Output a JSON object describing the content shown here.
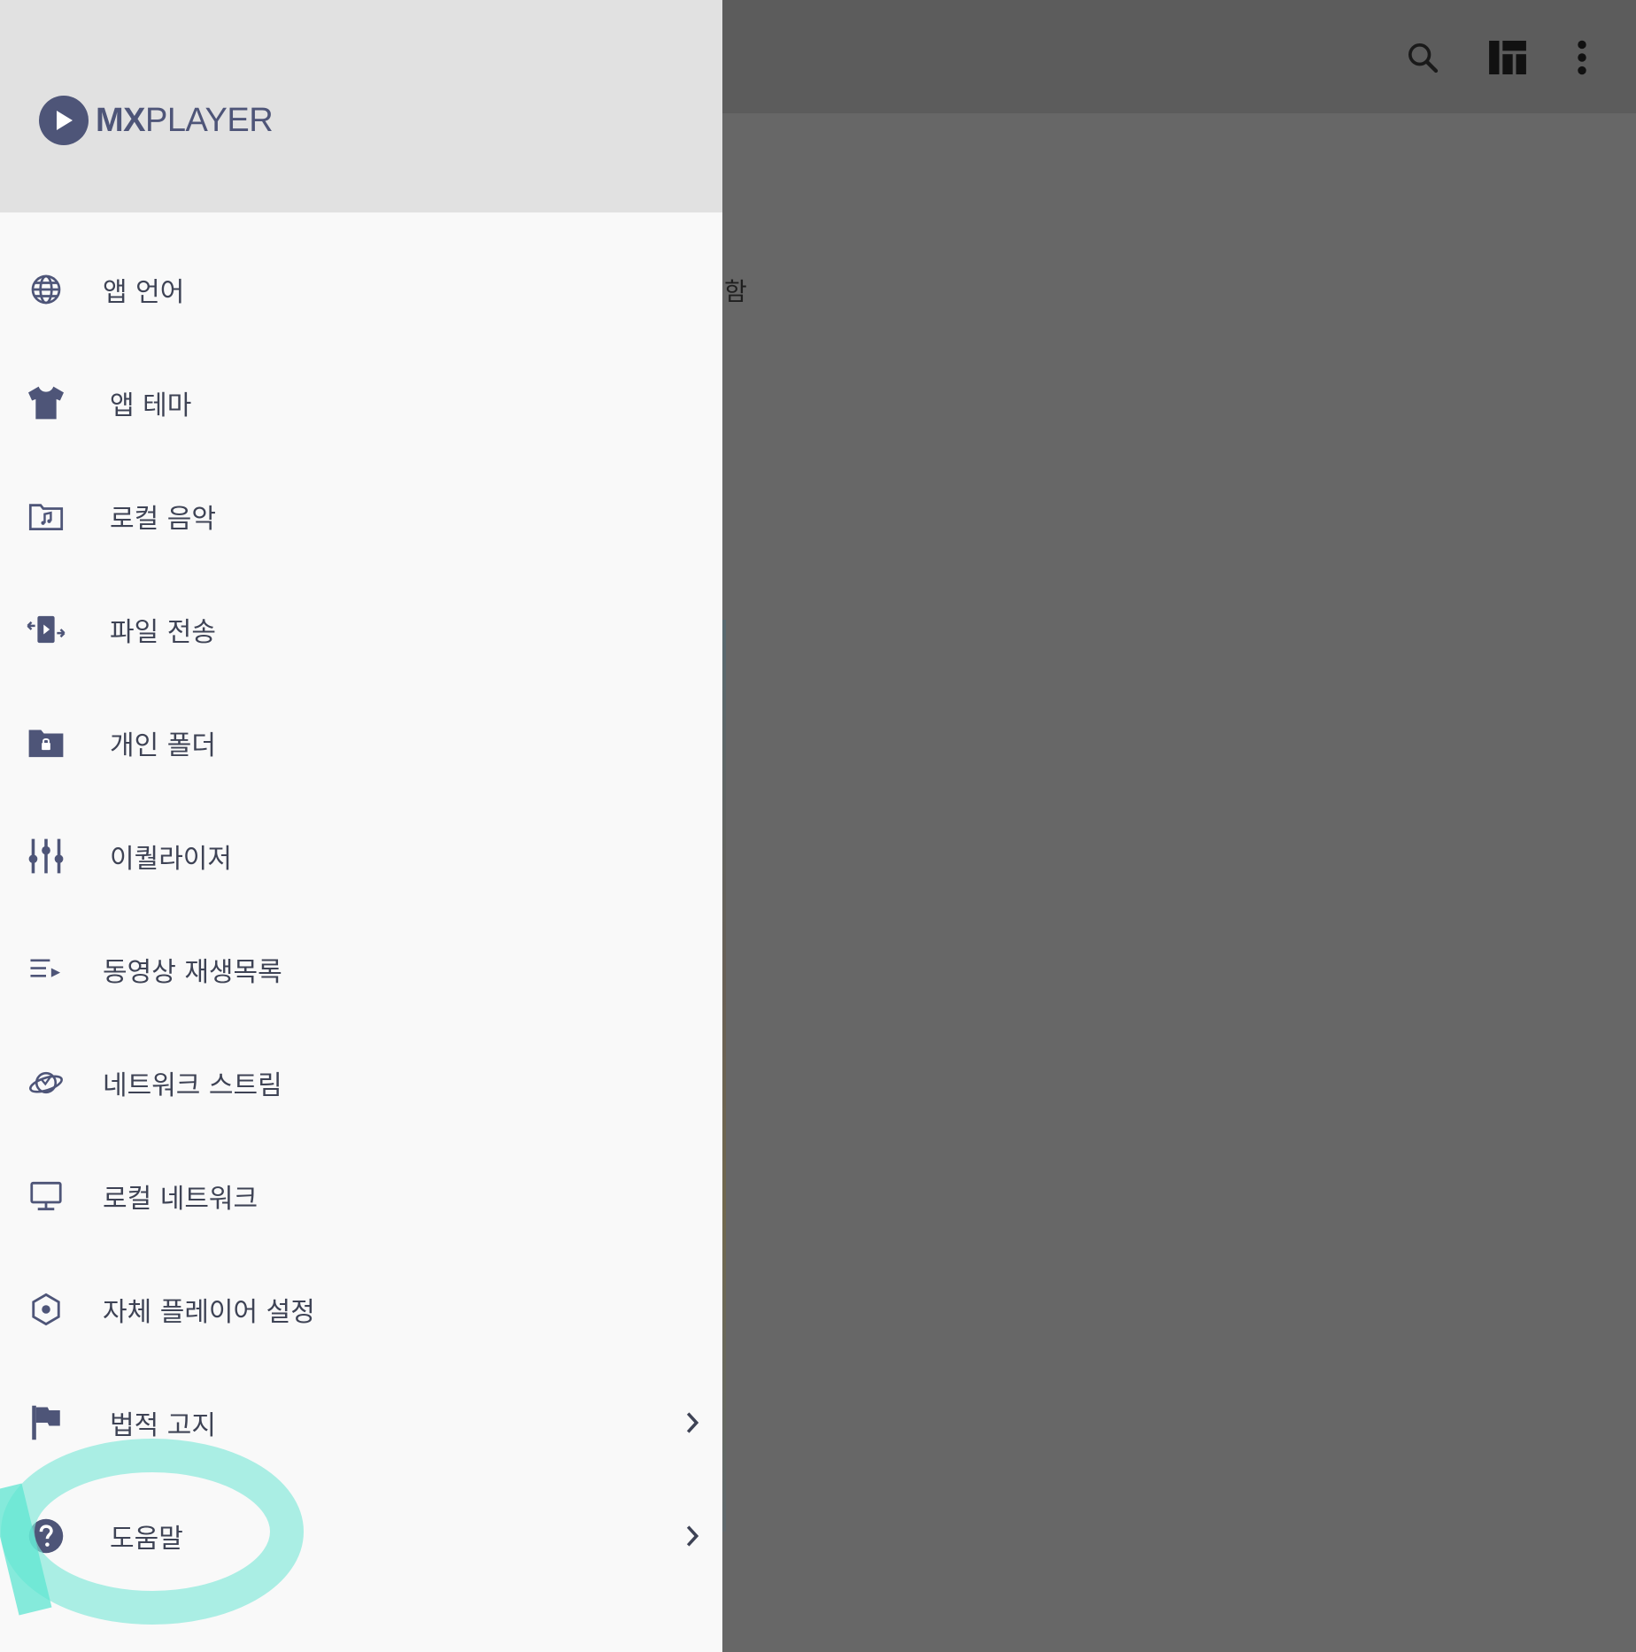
{
  "background": {
    "partial_text": "함",
    "toolbar": {
      "search_icon": "search-icon",
      "layout_icon": "grid-layout-icon",
      "more_icon": "more-vertical-icon"
    }
  },
  "drawer": {
    "logo": {
      "mx": "MX",
      "player": "PLAYER"
    },
    "items": [
      {
        "label": "앱 언어",
        "icon": "globe-icon"
      },
      {
        "label": "앱 테마",
        "icon": "tshirt-icon"
      },
      {
        "label": "로컬 음악",
        "icon": "music-folder-icon"
      },
      {
        "label": "파일 전송",
        "icon": "file-transfer-icon"
      },
      {
        "label": "개인 폴더",
        "icon": "lock-folder-icon"
      },
      {
        "label": "이퀄라이저",
        "icon": "equalizer-icon"
      },
      {
        "label": "동영상 재생목록",
        "icon": "playlist-icon"
      },
      {
        "label": "네트워크 스트림",
        "icon": "planet-icon"
      },
      {
        "label": "로컬 네트워크",
        "icon": "monitor-icon"
      },
      {
        "label": "자체 플레이어 설정",
        "icon": "hexagon-settings-icon"
      },
      {
        "label": "법적 고지",
        "icon": "flag-icon",
        "has_chevron": true
      },
      {
        "label": "도움말",
        "icon": "help-circle-icon",
        "has_chevron": true
      }
    ]
  },
  "colors": {
    "drawer_bg": "#f9f9f9",
    "header_bg": "#e1e1e1",
    "icon": "#4e5578",
    "text": "#3e4355",
    "scrim": "#676767",
    "highlight": "#7fe8d9"
  }
}
